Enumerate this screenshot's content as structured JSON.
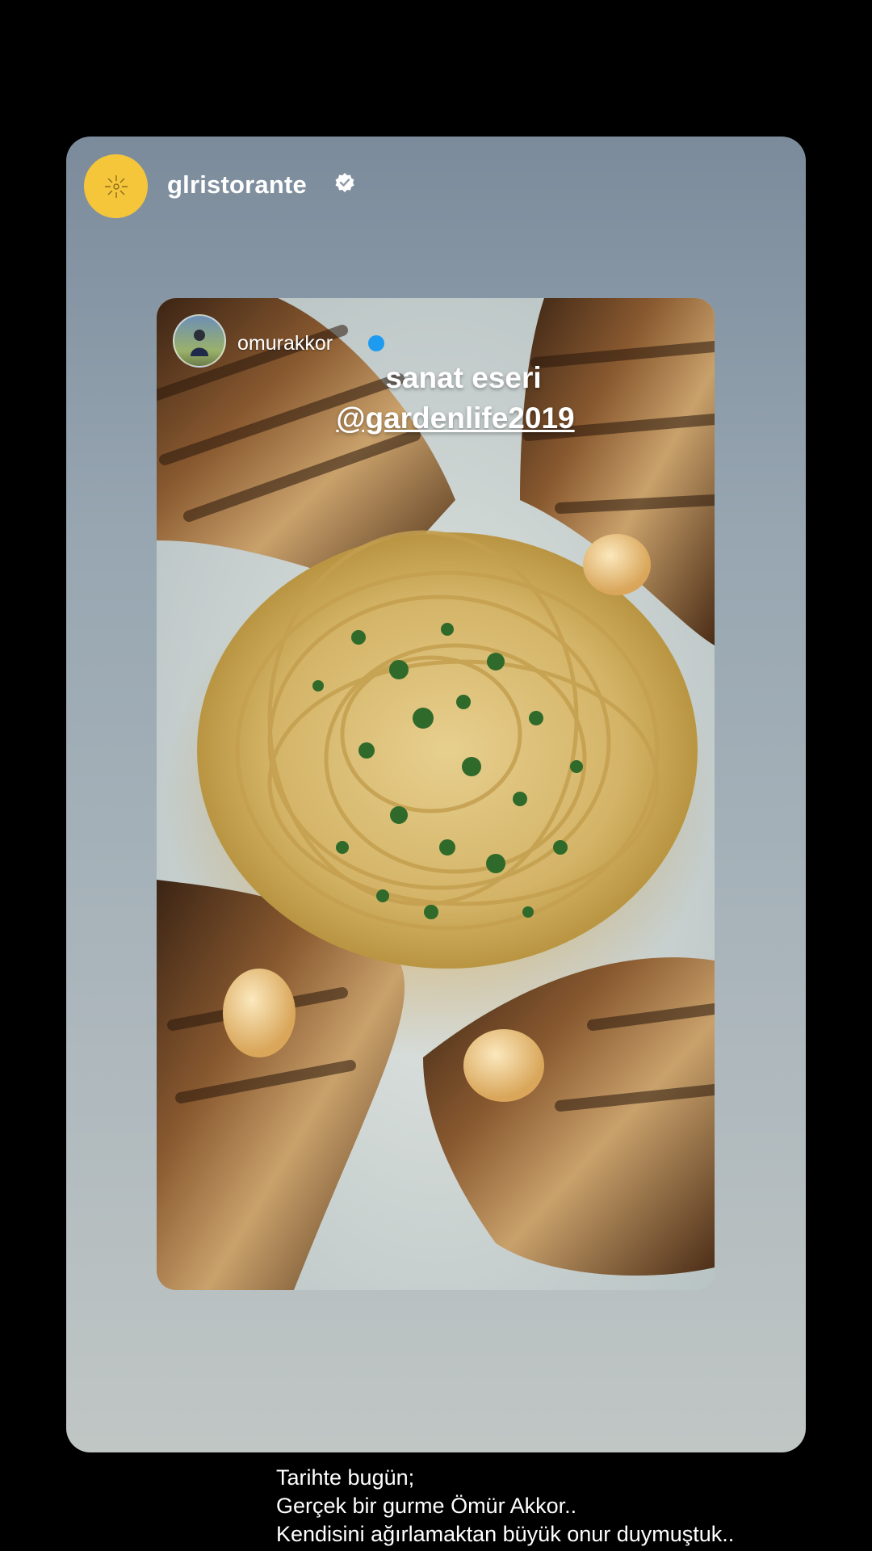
{
  "story": {
    "account_name": "glristorante",
    "avatar_color": "#f6c63a",
    "verified_icon": "verified-badge-icon"
  },
  "shared_post": {
    "author": "omurakkor",
    "verified_color": "#1d9bf0",
    "sticker_text": "sanat eseri",
    "mention": "@gardenlife2019"
  },
  "caption": {
    "lines": [
      "Tarihte bugün;",
      "Gerçek bir gurme Ömür Akkor..",
      "Kendisini ağırlamaktan büyük onur duymuştuk.."
    ]
  }
}
